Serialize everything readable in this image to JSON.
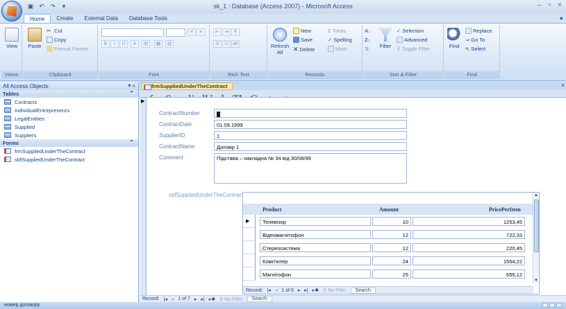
{
  "window": {
    "title": "sk_1 : Database (Access 2007) - Microsoft Access"
  },
  "ribbon": {
    "tabs": [
      "Home",
      "Create",
      "External Data",
      "Database Tools"
    ],
    "groups": {
      "views": {
        "label": "Views",
        "view": "View"
      },
      "clipboard": {
        "label": "Clipboard",
        "paste": "Paste",
        "cut": "Cut",
        "copy": "Copy",
        "format_painter": "Format Painter"
      },
      "font": {
        "label": "Font"
      },
      "rich_text": {
        "label": "Rich Text"
      },
      "records": {
        "label": "Records",
        "refresh": "Refresh All",
        "new": "New",
        "save": "Save",
        "delete": "Delete",
        "totals": "Totals",
        "spelling": "Spelling",
        "more": "More"
      },
      "sort_filter": {
        "label": "Sort & Filter",
        "filter": "Filter",
        "selection": "Selection",
        "advanced": "Advanced",
        "toggle_filter": "Toggle Filter"
      },
      "find": {
        "label": "Find",
        "find": "Find",
        "replace": "Replace",
        "goto": "Go To",
        "select": "Select"
      }
    }
  },
  "nav_pane": {
    "header": "All Access Objects",
    "sections": [
      {
        "title": "Tables",
        "items": [
          "Contracts",
          "IndividualEntrepreneurs",
          "LegalEntities",
          "Supplied",
          "Suppliers"
        ]
      },
      {
        "title": "Forms",
        "items": [
          "frmSuppliedUnderTheContract",
          "sbfSuppliedUnderTheContract"
        ]
      }
    ]
  },
  "document": {
    "tab_label": "frmSuppliedUnderTheContract",
    "form_title": "frmSuppliedUnderTheContract",
    "fields": [
      {
        "label": "ContractNumber",
        "value": ""
      },
      {
        "label": "ContractDate",
        "value": "01.09.1999"
      },
      {
        "label": "SupplierID",
        "value": "1"
      },
      {
        "label": "ContractName",
        "value": "Договір 1"
      },
      {
        "label": "Comment",
        "value": "Підстава – накладна № 34 від 30/08/99"
      }
    ],
    "subform": {
      "label": "sbfSuppliedUnderTheContract",
      "columns": [
        "Product",
        "Amount",
        "PricePerItem"
      ],
      "rows": [
        {
          "product": "Телевізор",
          "amount": "10",
          "price": "1253,45"
        },
        {
          "product": "Відеомагнітофон",
          "amount": "12",
          "price": "722,33"
        },
        {
          "product": "Стереосистема",
          "amount": "12",
          "price": "220,45"
        },
        {
          "product": "Комп'ютер",
          "amount": "24",
          "price": "1554,22"
        },
        {
          "product": "Магнітофон",
          "amount": "25",
          "price": "655,12"
        }
      ],
      "nav": {
        "record": "Record:",
        "position": "1 of 5",
        "no_filter": "No Filter",
        "search": "Search"
      }
    },
    "main_nav": {
      "record": "Record:",
      "position": "1 of 7",
      "no_filter": "No Filter",
      "search": "Search"
    }
  },
  "status_bar": {
    "text": "номер договору"
  }
}
